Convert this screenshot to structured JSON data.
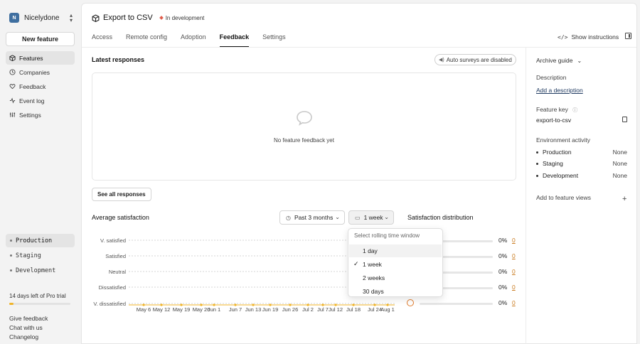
{
  "workspace": {
    "initial": "N",
    "name": "Nicelydone"
  },
  "sidebar": {
    "new_feature": "New feature",
    "items": [
      {
        "label": "Features",
        "icon": "box-icon",
        "active": true
      },
      {
        "label": "Companies",
        "icon": "building-icon"
      },
      {
        "label": "Feedback",
        "icon": "heart-icon"
      },
      {
        "label": "Event log",
        "icon": "log-icon"
      },
      {
        "label": "Settings",
        "icon": "settings-icon"
      }
    ],
    "environments": [
      "Production",
      "Staging",
      "Development"
    ],
    "trial": {
      "text": "14 days left of Pro trial",
      "progress": 0.07
    },
    "footer": [
      "Give feedback",
      "Chat with us",
      "Changelog"
    ]
  },
  "header": {
    "title": "Export to CSV",
    "status": "In development",
    "status_color": "#e05d4c",
    "tabs": [
      "Access",
      "Remote config",
      "Adoption",
      "Feedback",
      "Settings"
    ],
    "active_tab": "Feedback",
    "show_instructions": "Show instructions"
  },
  "responses": {
    "title": "Latest responses",
    "auto_surveys": "Auto surveys are disabled",
    "empty_text": "No feature feedback yet",
    "see_all": "See all responses"
  },
  "satisfaction": {
    "title": "Average satisfaction",
    "range_select": "Past 3 months",
    "window_select": "1 week",
    "distribution_title": "Satisfaction distribution",
    "distribution": [
      {
        "pct": "0%",
        "count": "0"
      },
      {
        "pct": "0%",
        "count": "0"
      },
      {
        "pct": "0%",
        "count": "0"
      },
      {
        "pct": "0%",
        "count": "0"
      },
      {
        "pct": "0%",
        "count": "0"
      }
    ]
  },
  "dropdown": {
    "heading": "Select rolling time window",
    "options": [
      "1 day",
      "1 week",
      "2 weeks",
      "30 days"
    ],
    "selected": "1 week",
    "hovered": "1 day"
  },
  "right_panel": {
    "archive": "Archive guide",
    "description_label": "Description",
    "description_link": "Add a description",
    "feature_key_label": "Feature key",
    "feature_key": "export-to-csv",
    "env_activity_label": "Environment activity",
    "env_activity": [
      {
        "name": "Production",
        "value": "None"
      },
      {
        "name": "Staging",
        "value": "None"
      },
      {
        "name": "Development",
        "value": "None"
      }
    ],
    "add_views": "Add to feature views"
  },
  "chart_data": {
    "type": "line",
    "y_categories": [
      "V. satisfied",
      "Satisfied",
      "Neutral",
      "Dissatisfied",
      "V. dissatisfied"
    ],
    "x": [
      "May 6",
      "May 12",
      "May 19",
      "May 26",
      "Jun 1",
      "Jun 7",
      "Jun 13",
      "Jun 19",
      "Jun 26",
      "Jul 2",
      "Jul 7",
      "Jul 12",
      "Jul 18",
      "Jul 24",
      "Aug 1"
    ],
    "series": [],
    "grid": true,
    "accent_color": "#f0b429"
  }
}
